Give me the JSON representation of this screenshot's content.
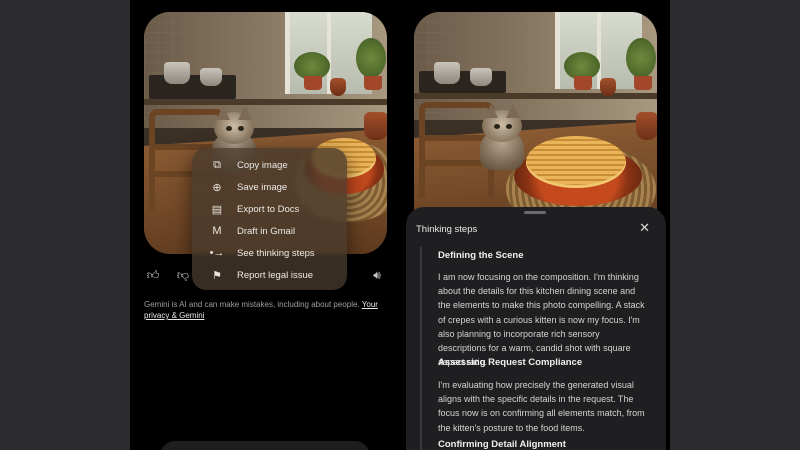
{
  "context_menu": {
    "items": [
      {
        "label": "Copy image",
        "icon": "copy-icon"
      },
      {
        "label": "Save image",
        "icon": "save-icon"
      },
      {
        "label": "Export to Docs",
        "icon": "docs-icon"
      },
      {
        "label": "Draft in Gmail",
        "icon": "gmail-icon"
      },
      {
        "label": "See thinking steps",
        "icon": "thinking-steps-icon"
      },
      {
        "label": "Report legal issue",
        "icon": "flag-icon"
      }
    ]
  },
  "actions": [
    "thumbs-up-icon",
    "thumbs-down-icon",
    "speaker-icon"
  ],
  "disclaimer": {
    "text": "Gemini is AI and can make mistakes, including about people. ",
    "link": "Your privacy & Gemini"
  },
  "thinking_panel": {
    "title": "Thinking steps",
    "steps": [
      {
        "heading": "Defining the Scene",
        "body": "I am now focusing on the composition. I'm thinking about the details for this kitchen dining scene and the elements to make this photo compelling. A stack of crepes with a curious kitten is now my focus. I'm also planning to incorporate rich sensory descriptions for a warm, candid shot with square aspect ratio."
      },
      {
        "heading": "Assessing Request Compliance",
        "body": "I'm evaluating how precisely the generated visual aligns with the specific details in the request. The focus now is on confirming all elements match, from the kitten's posture to the food items."
      },
      {
        "heading": "Confirming Detail Alignment",
        "body": ""
      }
    ]
  },
  "colors": {
    "menu_bg": "#483a2c",
    "sheet_bg": "#1f1f21",
    "page_bg": "#000000"
  }
}
